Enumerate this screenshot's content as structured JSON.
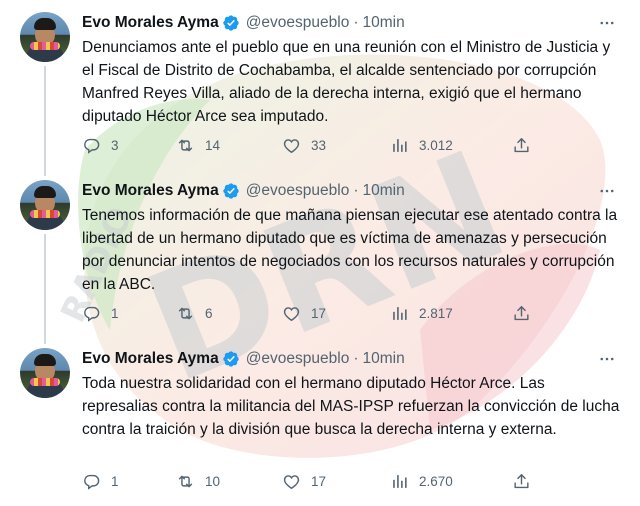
{
  "tweets": [
    {
      "name": "Evo Morales Ayma",
      "handle": "@evoespueblo",
      "separator": "·",
      "time": "10min",
      "text": "Denunciamos ante el pueblo que en una reunión con el Ministro de Justicia y el Fiscal de Distrito de Cochabamba, el alcalde sentenciado por corrupción Manfred Reyes Villa, aliado de la derecha interna, exigió que el hermano diputado Héctor Arce sea imputado.",
      "replies": "3",
      "retweets": "14",
      "likes": "33",
      "views": "3.012"
    },
    {
      "name": "Evo Morales Ayma",
      "handle": "@evoespueblo",
      "separator": "·",
      "time": "10min",
      "text": "Tenemos información de que mañana piensan ejecutar ese atentado contra la libertad de un hermano diputado que es víctima de amenazas y persecución por denunciar intentos de negociados con los recursos naturales y corrupción en la ABC.",
      "replies": "1",
      "retweets": "6",
      "likes": "17",
      "views": "2.817"
    },
    {
      "name": "Evo Morales Ayma",
      "handle": "@evoespueblo",
      "separator": "·",
      "time": "10min",
      "text": "Toda nuestra solidaridad con el hermano diputado Héctor Arce. Las represalias contra la militancia del MAS-IPSP refuerzan la convicción de lucha contra la traición y la división que busca la derecha interna y externa.",
      "replies": "1",
      "retweets": "10",
      "likes": "17",
      "views": "2.670"
    }
  ],
  "icons": {
    "verified": "verified-badge-icon",
    "more": "more-options-icon",
    "reply": "reply-icon",
    "retweet": "retweet-icon",
    "like": "like-icon",
    "views": "views-icon",
    "share": "share-icon"
  },
  "colors": {
    "verified": "#1d9bf0",
    "muted": "#536471",
    "text": "#0f1419",
    "thread_line": "#cfd9de"
  },
  "watermark": {
    "letters": "DRN",
    "small_text": "RADIO"
  }
}
